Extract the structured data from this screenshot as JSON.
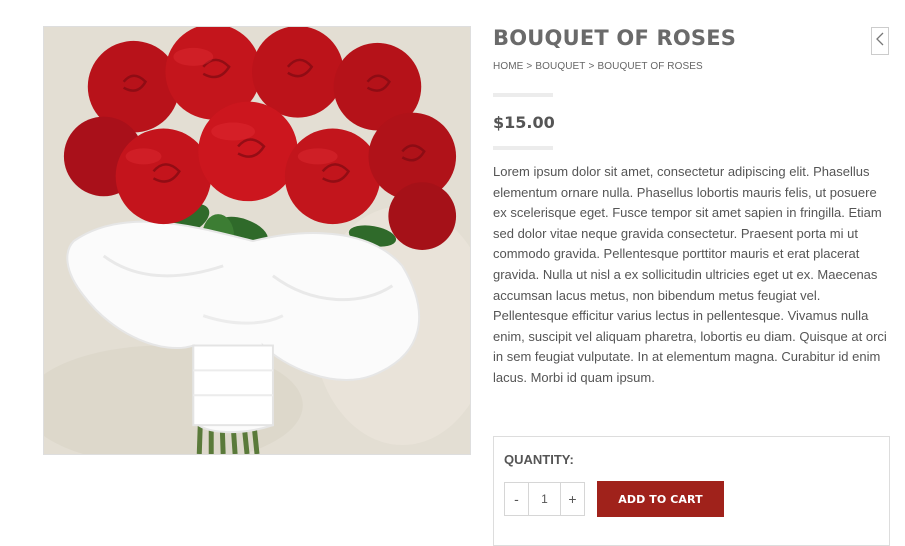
{
  "product": {
    "title": "BOUQUET OF ROSES",
    "price": "$15.00",
    "description": "Lorem ipsum dolor sit amet, consectetur adipiscing elit. Phasellus elementum ornare nulla. Phasellus lobortis mauris felis, ut posuere ex scelerisque eget. Fusce tempor sit amet sapien in fringilla. Etiam sed dolor vitae neque gravida consectetur. Praesent porta mi ut commodo gravida. Pellentesque porttitor mauris et erat placerat gravida. Nulla ut nisl a ex sollicitudin ultricies eget ut ex. Maecenas accumsan lacus metus, non bibendum metus feugiat vel. Pellentesque efficitur varius lectus in pellentesque. Vivamus nulla enim, suscipit vel aliquam pharetra, lobortis eu diam. Quisque at orci in sem feugiat vulputate. In at elementum magna. Curabitur id enim lacus. Morbi id quam ipsum."
  },
  "breadcrumb": {
    "items": [
      "HOME",
      "BOUQUET",
      "BOUQUET OF ROSES"
    ],
    "separator": ">"
  },
  "navigation": {
    "back_icon": "chevron-left-icon"
  },
  "purchase": {
    "quantity_label": "QUANTITY:",
    "quantity_value": "1",
    "decrement_label": "-",
    "increment_label": "+",
    "add_to_cart_label": "ADD TO CART"
  },
  "colors": {
    "accent": "#a0221b",
    "title": "#6a6a6a",
    "text": "#555555",
    "rose": "#c8141b",
    "ribbon": "#ffffff"
  }
}
